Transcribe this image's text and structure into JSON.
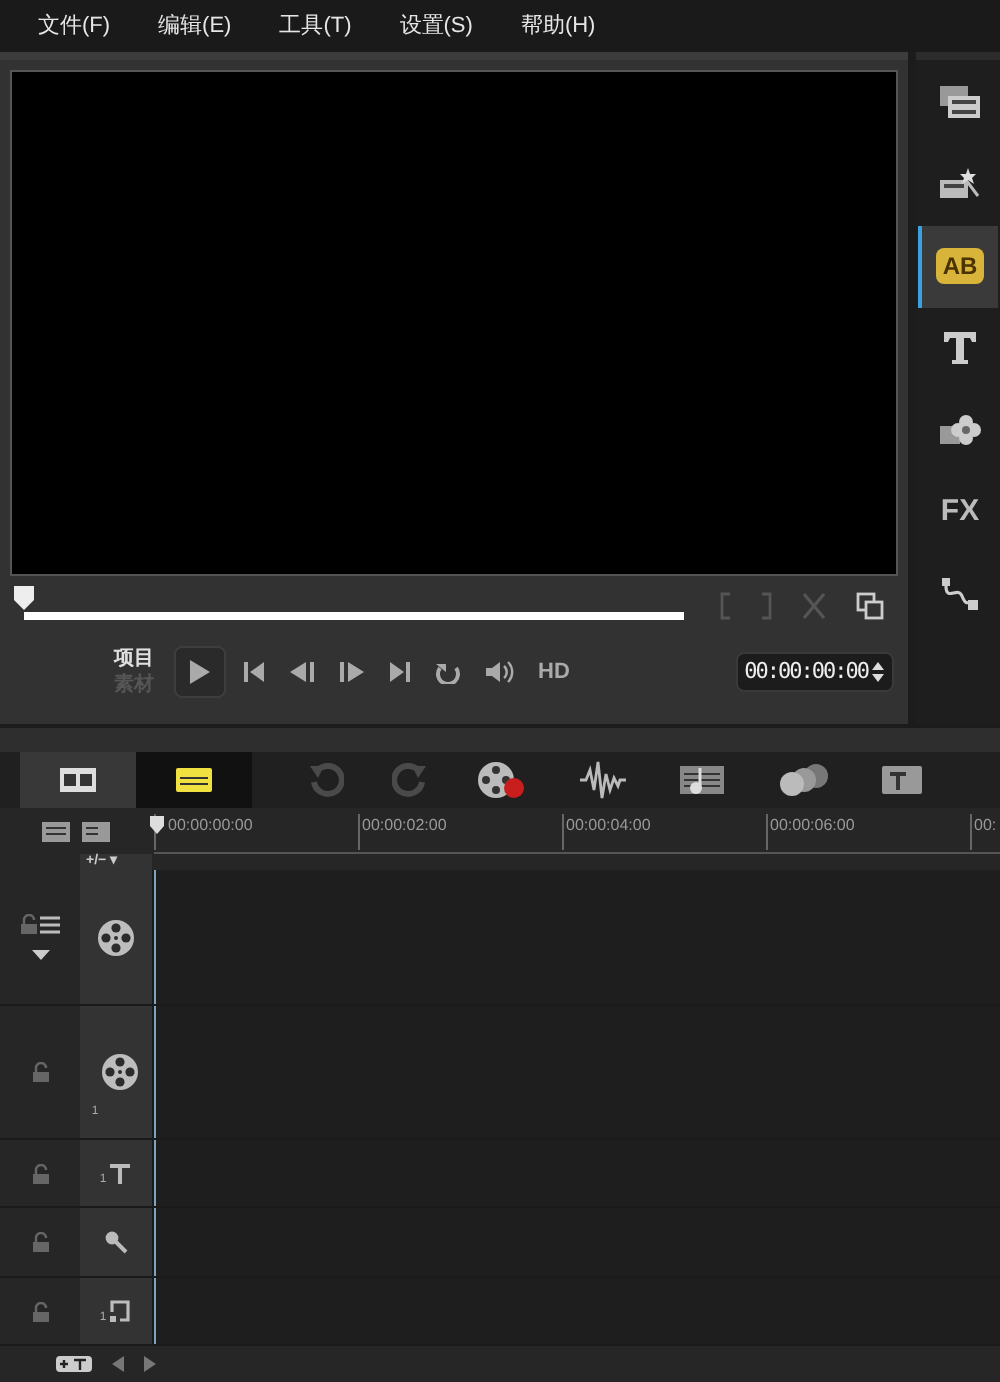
{
  "menu": [
    {
      "label": "文件(F)"
    },
    {
      "label": "编辑(E)"
    },
    {
      "label": "工具(T)"
    },
    {
      "label": "设置(S)"
    },
    {
      "label": "帮助(H)"
    }
  ],
  "player": {
    "scrub": {
      "level": 0
    },
    "modes": [
      {
        "label": "项目",
        "selected": true
      },
      {
        "label": "素材",
        "selected": false
      }
    ],
    "hd": "HD",
    "timecode": "00:00:00:00"
  },
  "sidebar": [
    {
      "kind": "media",
      "selected": false
    },
    {
      "kind": "instant",
      "selected": false
    },
    {
      "kind": "transition",
      "label": "AB",
      "selected": true
    },
    {
      "kind": "title",
      "selected": false
    },
    {
      "kind": "graphic",
      "selected": false
    },
    {
      "kind": "filter",
      "label": "FX",
      "selected": false
    },
    {
      "kind": "path",
      "selected": false
    }
  ],
  "toolbar": {
    "views": [
      {
        "kind": "storyboard",
        "selected": false
      },
      {
        "kind": "timeline",
        "selected": true
      }
    ],
    "tools": [
      {
        "kind": "undo",
        "disabled": true
      },
      {
        "kind": "redo",
        "disabled": true
      },
      {
        "kind": "record"
      },
      {
        "kind": "audio"
      },
      {
        "kind": "music"
      },
      {
        "kind": "motion"
      },
      {
        "kind": "subtitle"
      }
    ]
  },
  "ruler": {
    "track_manager": "+/−",
    "track_manager_arrow": "▾",
    "ticks": [
      "00:00:00:00",
      "00:00:02:00",
      "00:00:04:00",
      "00:00:06:00",
      "00:"
    ]
  },
  "tracks": [
    {
      "kind": "video"
    },
    {
      "kind": "overlay",
      "number": "1"
    },
    {
      "kind": "title",
      "number": "1"
    },
    {
      "kind": "voice"
    },
    {
      "kind": "music",
      "number": "1"
    }
  ]
}
